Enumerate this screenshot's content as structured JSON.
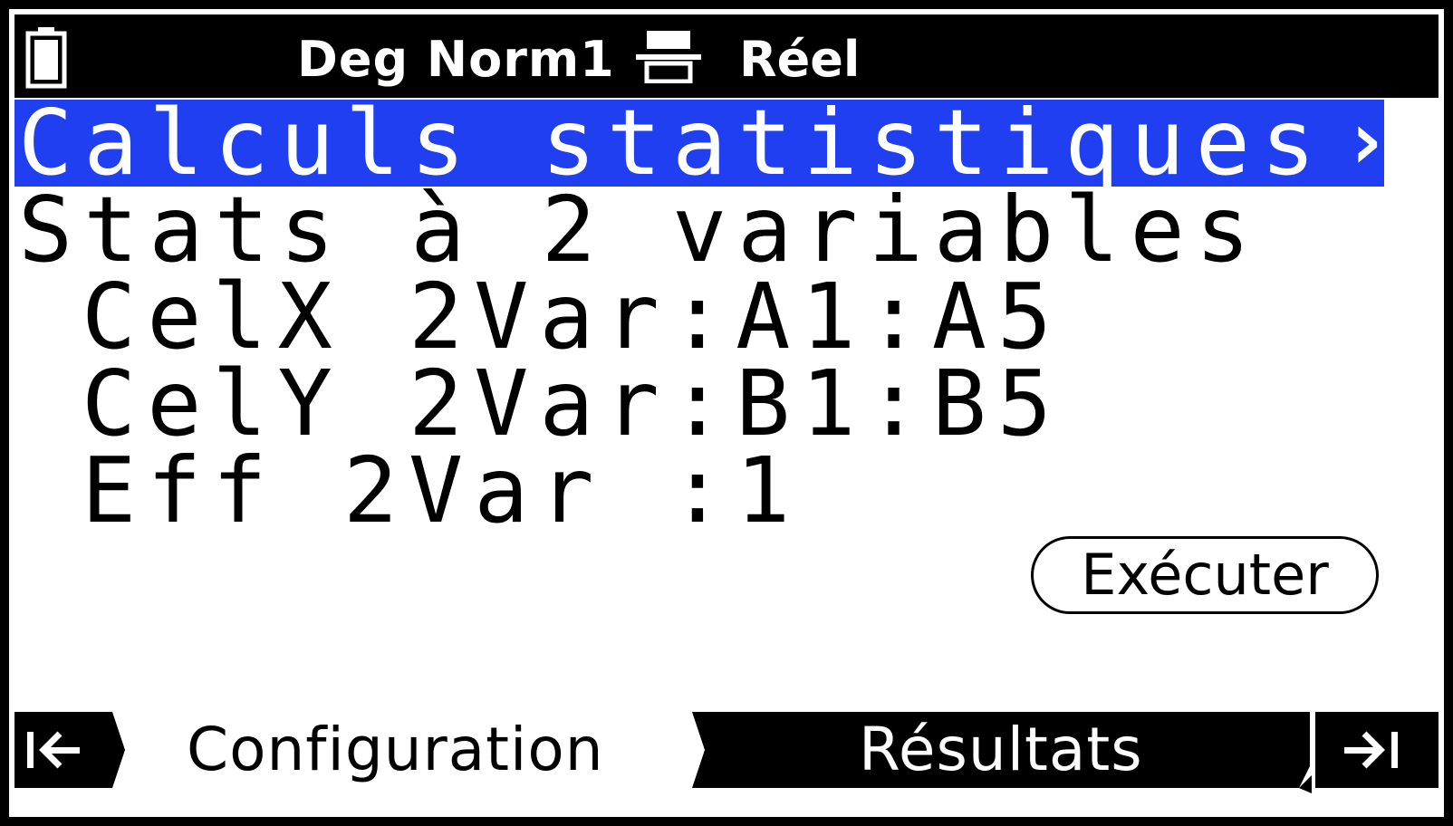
{
  "status_bar": {
    "mode": "Deg Norm1",
    "number_format": "Réel",
    "battery_icon": "battery-icon",
    "fraction_icon": "fraction-display-icon"
  },
  "title": {
    "text": "Calculs statistiques",
    "arrow": "›"
  },
  "content": {
    "mode_line": "Stats à 2 variables",
    "fields": [
      {
        "label": "CelX 2Var",
        "separator": ":",
        "value": "A1:A5"
      },
      {
        "label": "CelY 2Var",
        "separator": ":",
        "value": "B1:B5"
      },
      {
        "label": "Eff 2Var ",
        "separator": ":",
        "value": "1"
      }
    ]
  },
  "execute_button": {
    "label": "Exécuter"
  },
  "tabs": {
    "first_icon": "jump-to-first-icon",
    "items": [
      {
        "label": "Configuration",
        "active": true
      },
      {
        "label": "Résultats",
        "active": false
      }
    ],
    "last_icon": "jump-to-last-icon"
  },
  "colors": {
    "highlight": "#1f3ff0",
    "background": "#ffffff",
    "foreground": "#000000"
  }
}
